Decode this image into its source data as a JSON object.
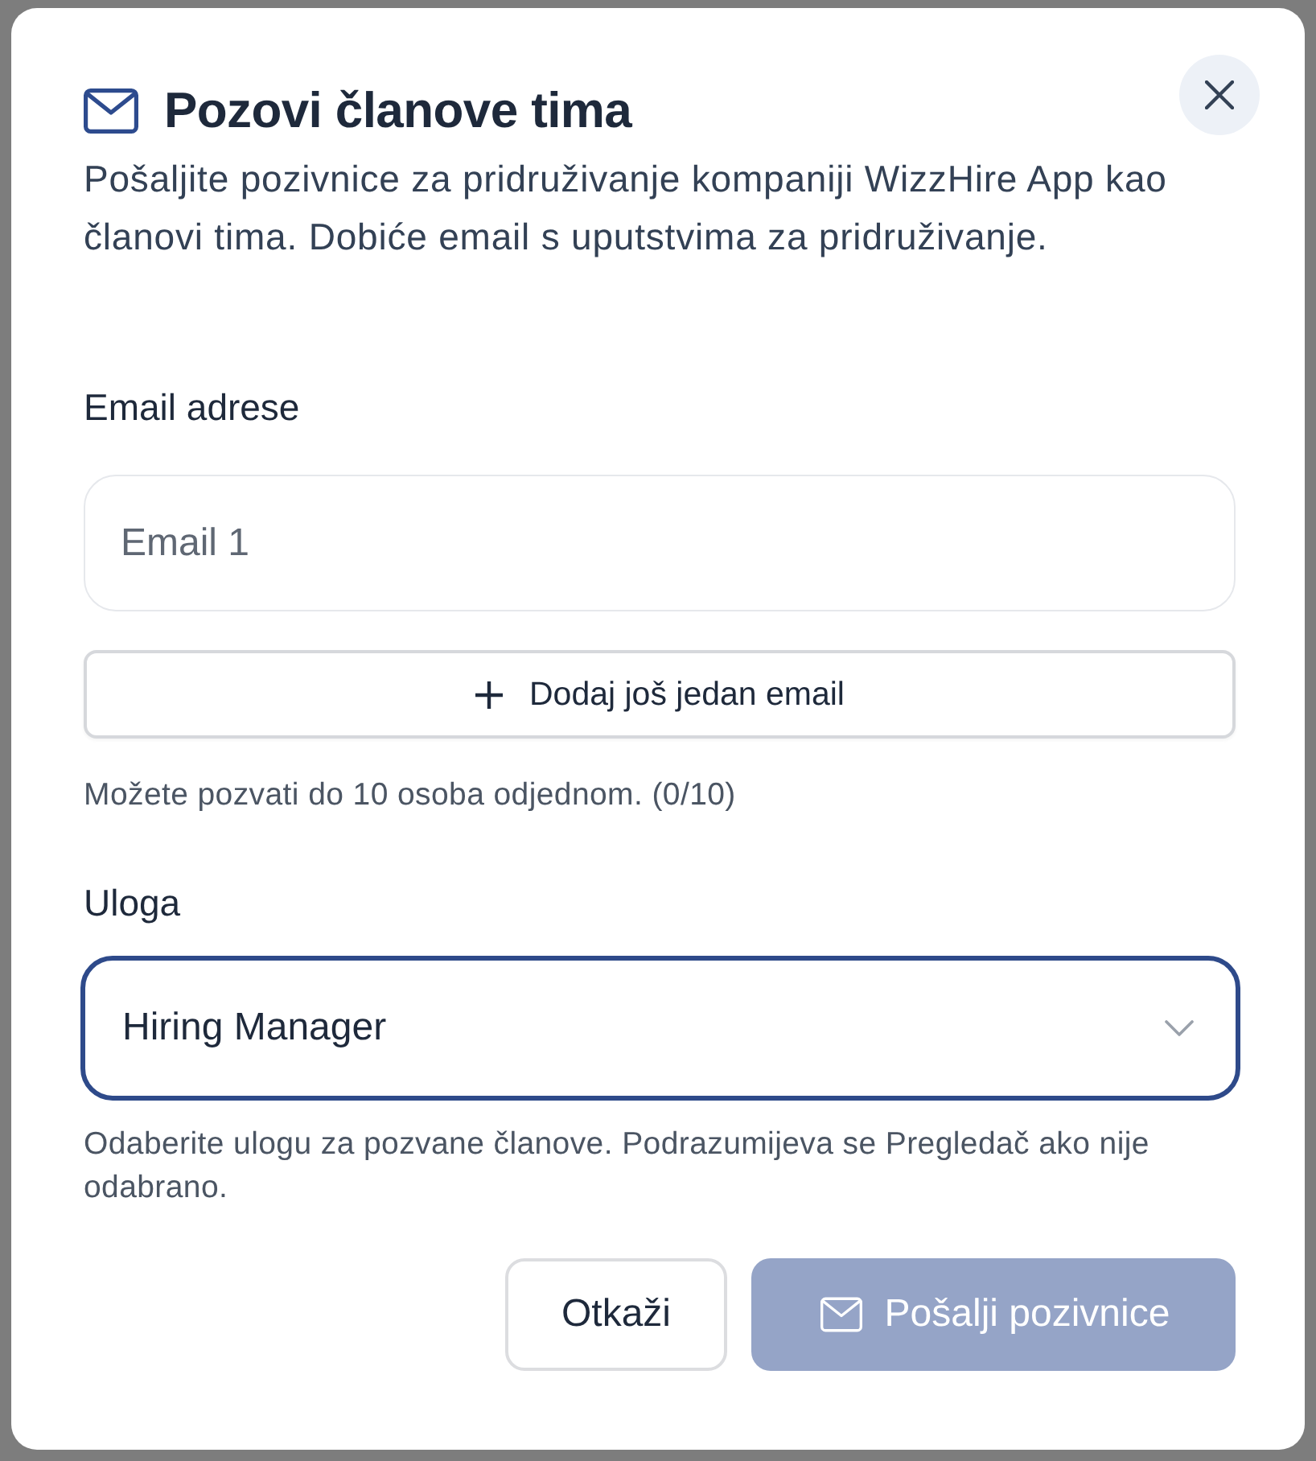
{
  "dialog": {
    "title": "Pozovi članove tima",
    "description": "Pošaljite pozivnice za pridruživanje kompaniji WizzHire App kao članovi tima. Dobiće email s uputstvima za pridruživanje."
  },
  "emails": {
    "label": "Email adrese",
    "fields": [
      {
        "placeholder": "Email 1"
      }
    ],
    "add_button": "Dodaj još jedan email",
    "hint": "Možete pozvati do 10 osoba odjednom. (0/10)"
  },
  "role": {
    "label": "Uloga",
    "value": "Hiring Manager",
    "focused": true,
    "hint": "Odaberite ulogu za pozvane članove. Podrazumijeva se Pregledač ako nije odabrano."
  },
  "actions": [
    {
      "label": "Otkaži",
      "kind": "secondary",
      "disabled": false
    },
    {
      "label": "Pošalji pozivnice",
      "kind": "primary",
      "disabled": true
    }
  ]
}
